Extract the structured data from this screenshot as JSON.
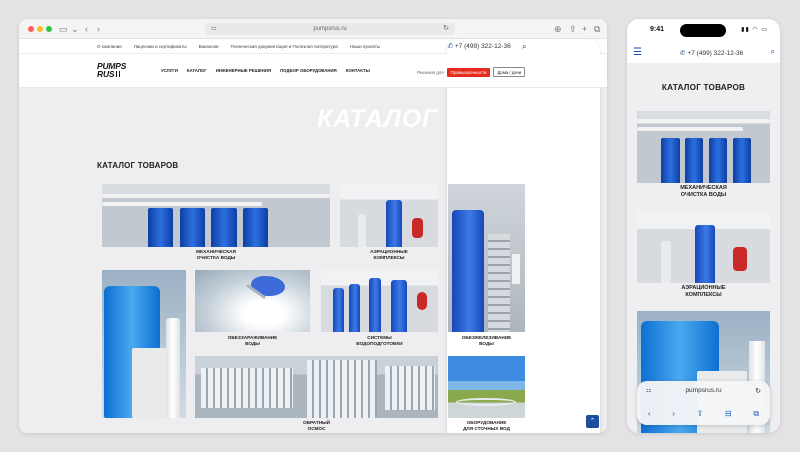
{
  "browser": {
    "url": "pumpsrus.ru",
    "nav_back_icon": "‹",
    "nav_forward_icon": "›"
  },
  "site": {
    "topnav": {
      "links": [
        "О компании",
        "Лицензии и сертификаты",
        "Вакансии",
        "Техническая документация и Полезная литература",
        "Наши проекты"
      ],
      "phone": "+7 (499) 322-12-36"
    },
    "logo": {
      "line1": "PUMPS",
      "line2": "RUS"
    },
    "menu": [
      "УСЛУГИ",
      "КАТАЛОГ",
      "ИНЖЕНЕРНЫЕ РЕШЕНИЯ",
      "ПОДБОР ОБОРУДОВАНИЯ",
      "КОНТАКТЫ"
    ],
    "solutions": {
      "label": "Решения для",
      "industrial": "Промышленности",
      "home": "Дома / дачи"
    },
    "hero": "КАТАЛОГ ТОВАРОВ",
    "catalog_title": "КАТАЛОГ ТОВАРОВ",
    "tiles": [
      {
        "line1": "МЕХАНИЧЕСКАЯ",
        "line2": "ОЧИСТКА ВОДЫ"
      },
      {
        "line1": "АЭРАЦИОННЫЕ",
        "line2": "КОМПЛЕКСЫ"
      },
      {
        "line1": "ОБЕЗЖЕЛЕЗИВАНИЕ",
        "line2": "ВОДЫ"
      },
      {
        "line1": "ОБЕЗЗАРАЖИВАНИЕ",
        "line2": "ВОДЫ"
      },
      {
        "line1": "СИСТЕМЫ",
        "line2": "ВОДОПОДГОТОВКИ"
      },
      {
        "line1": "ОБРАТНЫЙ",
        "line2": "ОСМОС"
      },
      {
        "line1": "ОБОРУДОВАНИЕ",
        "line2": "ДЛЯ СТОЧНЫХ ВОД"
      }
    ]
  },
  "phone": {
    "time": "9:41",
    "header_phone": "+7 (499) 322-12-36",
    "title": "КАТАЛОГ ТОВАРОВ",
    "tiles": [
      {
        "line1": "МЕХАНИЧЕСКАЯ",
        "line2": "ОЧИСТКА ВОДЫ"
      },
      {
        "line1": "АЭРАЦИОННЫЕ",
        "line2": "КОМПЛЕКСЫ"
      }
    ],
    "url": "pumpsrus.ru"
  },
  "colors": {
    "brand_blue": "#1d4e9e",
    "accent_red": "#e42d1f"
  }
}
